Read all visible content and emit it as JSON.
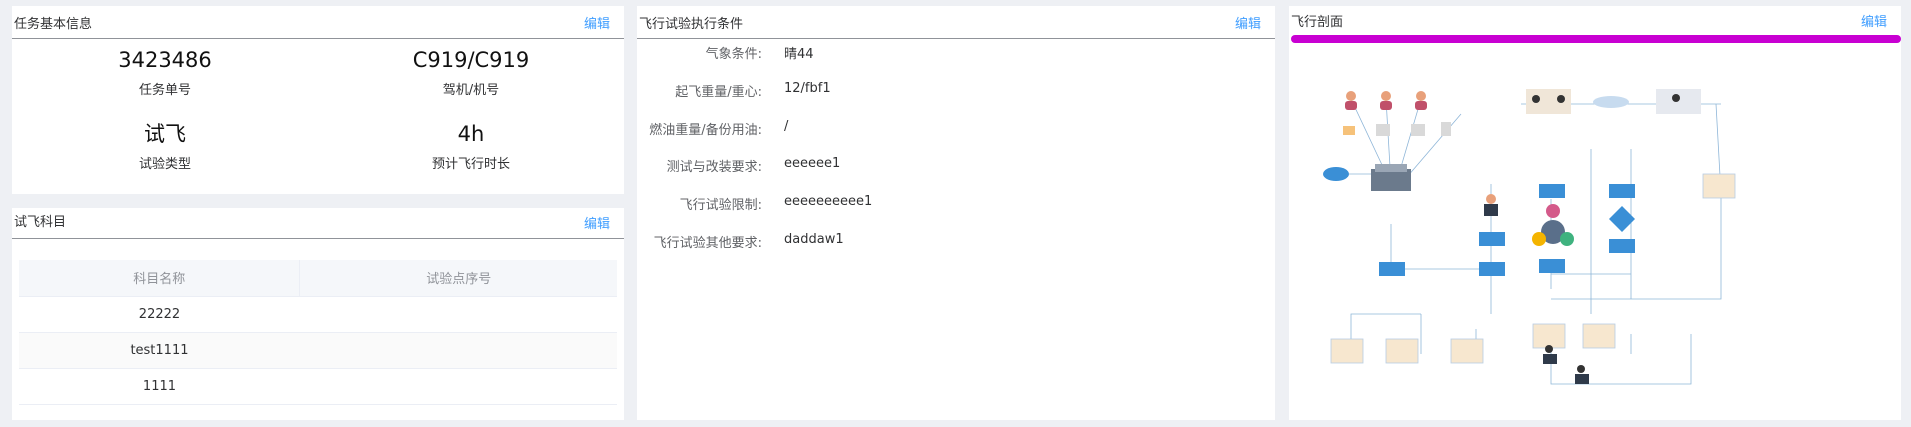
{
  "basic": {
    "title": "任务基本信息",
    "edit": "编辑",
    "cells": [
      {
        "value": "3423486",
        "label": "任务单号"
      },
      {
        "value": "C919/C919",
        "label": "驾机/机号"
      },
      {
        "value": "试飞",
        "label": "试验类型"
      },
      {
        "value": "4h",
        "label": "预计飞行时长"
      }
    ]
  },
  "subjects": {
    "title": "试飞科目",
    "edit": "编辑",
    "columns": [
      "科目名称",
      "试验点序号"
    ],
    "rows": [
      {
        "name": "22222",
        "point": ""
      },
      {
        "name": "test1111",
        "point": ""
      },
      {
        "name": "1111",
        "point": ""
      }
    ]
  },
  "conditions": {
    "title": "飞行试验执行条件",
    "edit": "编辑",
    "items": [
      {
        "label": "气象条件:",
        "value": "晴44"
      },
      {
        "label": "起飞重量/重心:",
        "value": "12/fbf1"
      },
      {
        "label": "燃油重量/备份用油:",
        "value": "/"
      },
      {
        "label": "测试与改装要求:",
        "value": "eeeeee1"
      },
      {
        "label": "飞行试验限制:",
        "value": "eeeeeeeeee1"
      },
      {
        "label": "飞行试验其他要求:",
        "value": "daddaw1"
      }
    ]
  },
  "profile": {
    "title": "飞行剖面",
    "edit": "编辑",
    "bar_color": "#c800d2"
  },
  "colors": {
    "accent": "#409eff",
    "background": "#eef0f4"
  }
}
